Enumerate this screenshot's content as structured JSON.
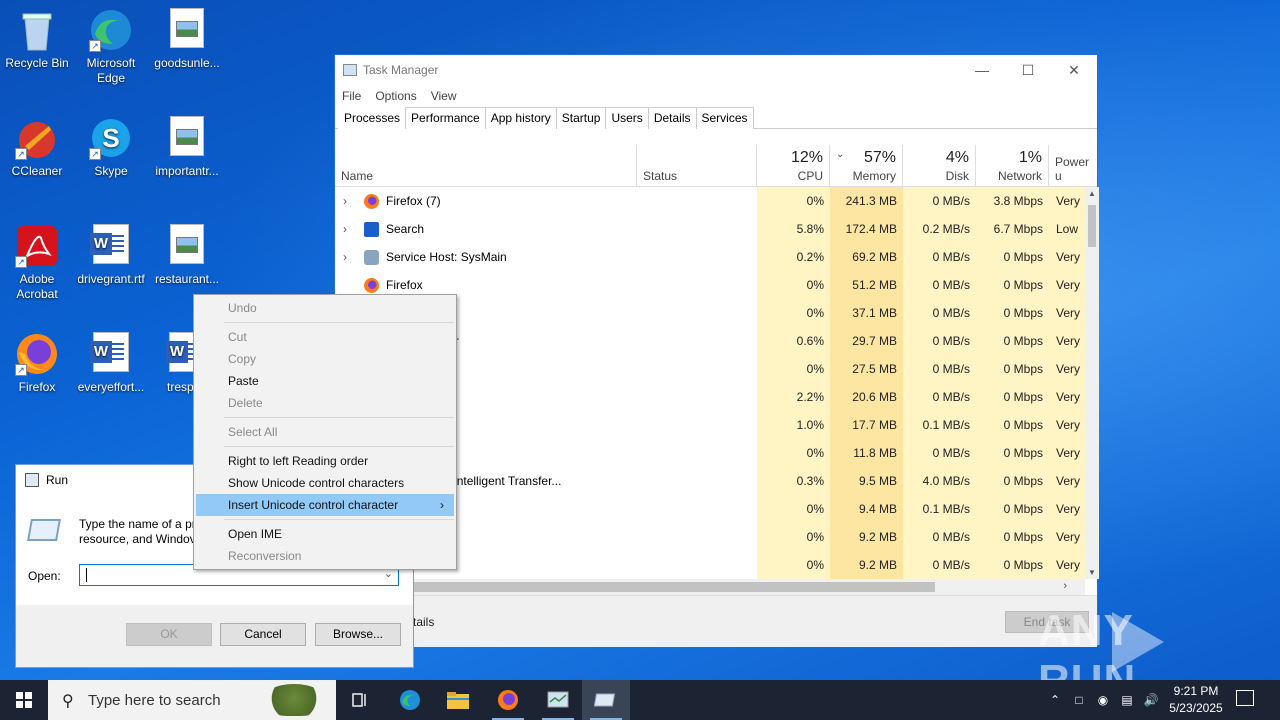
{
  "desktop": {
    "icons": [
      {
        "label": "Recycle Bin"
      },
      {
        "label": "Microsoft Edge"
      },
      {
        "label": "goodsunle..."
      },
      {
        "label": "CCleaner"
      },
      {
        "label": "Skype"
      },
      {
        "label": "importantr..."
      },
      {
        "label": "Adobe Acrobat"
      },
      {
        "label": "drivegrant.rtf"
      },
      {
        "label": "restaurant..."
      },
      {
        "label": "Firefox"
      },
      {
        "label": "everyeffort..."
      },
      {
        "label": "trespon"
      }
    ]
  },
  "task_manager": {
    "title": "Task Manager",
    "window_controls": {
      "minimize": "—",
      "maximize": "☐",
      "close": "✕"
    },
    "menu": [
      "File",
      "Options",
      "View"
    ],
    "tabs": [
      "Processes",
      "Performance",
      "App history",
      "Startup",
      "Users",
      "Details",
      "Services"
    ],
    "active_tab": "Processes",
    "columns": {
      "name": "Name",
      "status": "Status",
      "cpu": {
        "pct": "12%",
        "label": "CPU"
      },
      "memory": {
        "pct": "57%",
        "label": "Memory"
      },
      "disk": {
        "pct": "4%",
        "label": "Disk"
      },
      "network": {
        "pct": "1%",
        "label": "Network"
      },
      "power": {
        "label": "Power u"
      }
    },
    "rows": [
      {
        "name": "Firefox (7)",
        "expandable": true,
        "icon": "firefox-icon",
        "cpu": "0%",
        "mem": "241.3 MB",
        "disk": "0 MB/s",
        "net": "3.8 Mbps",
        "pow": "Very"
      },
      {
        "name": "Search",
        "expandable": true,
        "icon": "search-app-icon",
        "cpu": "5.8%",
        "mem": "172.4 MB",
        "disk": "0.2 MB/s",
        "net": "6.7 Mbps",
        "pow": "Low"
      },
      {
        "name": "Service Host: SysMain",
        "expandable": true,
        "icon": "gear-icon",
        "cpu": "0.2%",
        "mem": "69.2 MB",
        "disk": "0 MB/s",
        "net": "0 Mbps",
        "pow": "Very"
      },
      {
        "name": "Firefox",
        "expandable": false,
        "icon": "firefox-icon",
        "cpu": "0%",
        "mem": "51.2 MB",
        "disk": "0 MB/s",
        "net": "0 Mbps",
        "pow": "Very"
      },
      {
        "name": "ge",
        "expandable": false,
        "icon": "",
        "cpu": "0%",
        "mem": "37.1 MB",
        "disk": "0 MB/s",
        "net": "0 Mbps",
        "pow": "Very"
      },
      {
        "name": "dow Manager",
        "expandable": false,
        "icon": "",
        "cpu": "0.6%",
        "mem": "29.7 MB",
        "disk": "0 MB/s",
        "net": "0 Mbps",
        "pow": "Very"
      },
      {
        "name": "",
        "expandable": false,
        "icon": "",
        "cpu": "0%",
        "mem": "27.5 MB",
        "disk": "0 MB/s",
        "net": "0 Mbps",
        "pow": "Very"
      },
      {
        "name": "lorer",
        "expandable": false,
        "icon": "",
        "cpu": "2.2%",
        "mem": "20.6 MB",
        "disk": "0 MB/s",
        "net": "0 Mbps",
        "pow": "Very"
      },
      {
        "name": "",
        "expandable": false,
        "icon": "",
        "cpu": "1.0%",
        "mem": "17.7 MB",
        "disk": "0.1 MB/s",
        "net": "0 Mbps",
        "pow": "Very"
      },
      {
        "name": "",
        "expandable": false,
        "icon": "",
        "cpu": "0%",
        "mem": "11.8 MB",
        "disk": "0 MB/s",
        "net": "0 Mbps",
        "pow": "Very"
      },
      {
        "name": "Background Intelligent Transfer...",
        "expandable": false,
        "icon": "",
        "cpu": "0.3%",
        "mem": "9.5 MB",
        "disk": "4.0 MB/s",
        "net": "0 Mbps",
        "pow": "Very"
      },
      {
        "name": "",
        "expandable": false,
        "icon": "",
        "cpu": "0%",
        "mem": "9.4 MB",
        "disk": "0.1 MB/s",
        "net": "0 Mbps",
        "pow": "Very"
      },
      {
        "name": "",
        "expandable": false,
        "icon": "",
        "cpu": "0%",
        "mem": "9.2 MB",
        "disk": "0 MB/s",
        "net": "0 Mbps",
        "pow": "Very"
      },
      {
        "name": "",
        "expandable": false,
        "icon": "",
        "cpu": "0%",
        "mem": "9.2 MB",
        "disk": "0 MB/s",
        "net": "0 Mbps",
        "pow": "Very"
      }
    ],
    "footer": {
      "details": "tails",
      "end_task": "End task"
    },
    "colors": {
      "cpu_bg": "#fff4c4",
      "mem_bg": "#fde6a1",
      "default_bg": "#fff4c4",
      "accent": "#1a73d9"
    }
  },
  "run_dialog": {
    "title": "Run",
    "description_line1": "Type the name of a pr",
    "description_line2": "resource, and Windov",
    "open_label": "Open:",
    "open_value": "",
    "buttons": {
      "ok": "OK",
      "cancel": "Cancel",
      "browse": "Browse..."
    }
  },
  "context_menu": {
    "items": [
      {
        "label": "Undo",
        "disabled": true
      },
      {
        "sep": true
      },
      {
        "label": "Cut",
        "disabled": true
      },
      {
        "label": "Copy",
        "disabled": true
      },
      {
        "label": "Paste",
        "disabled": false
      },
      {
        "label": "Delete",
        "disabled": true
      },
      {
        "sep": true
      },
      {
        "label": "Select All",
        "disabled": true
      },
      {
        "sep": true
      },
      {
        "label": "Right to left Reading order",
        "disabled": false
      },
      {
        "label": "Show Unicode control characters",
        "disabled": false
      },
      {
        "label": "Insert Unicode control character",
        "disabled": false,
        "highlighted": true,
        "submenu": true
      },
      {
        "sep": true
      },
      {
        "label": "Open IME",
        "disabled": false
      },
      {
        "label": "Reconversion",
        "disabled": true
      }
    ]
  },
  "taskbar": {
    "search_placeholder": "Type here to search",
    "apps": [
      "task-view-icon",
      "edge-icon",
      "file-explorer-icon",
      "firefox-icon",
      "task-manager-icon",
      "run-icon"
    ],
    "clock_time": "9:21 PM",
    "clock_date": "5/23/2025"
  },
  "watermark": {
    "text_left": "ANY",
    "text_right": "RUN"
  }
}
